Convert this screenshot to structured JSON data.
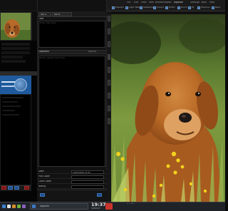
{
  "app": {
    "title": "digiKam",
    "menus": [
      "File",
      "Edit",
      "View",
      "Item",
      "Browse",
      "Import",
      "Settings",
      "Tools",
      "Help"
    ],
    "toolbar": [
      "Preview",
      "Light Table",
      "Slideshow",
      "Import",
      "Editor",
      "Zoom",
      "Fit",
      "Previous",
      "Next"
    ],
    "middle_tabs": [
      "Tab A",
      "Tab B"
    ]
  },
  "metadata_panel": {
    "title_label": "Title",
    "title_placeholder": "Enter title here.",
    "caption_label": "Captions",
    "caption_right": "Default",
    "caption_placeholder": "Enter caption text here.",
    "fields": [
      {
        "label": "Date",
        "value": "10/22/2013 14:37"
      },
      {
        "label": "Pick Label",
        "value": ""
      },
      {
        "label": "Color Label",
        "value": ""
      },
      {
        "label": "Rating",
        "value": ""
      }
    ]
  },
  "status": {
    "text": "1/1 item"
  },
  "taskbar": {
    "window_title": "digiKam",
    "time": "19:37",
    "date": "10/22/13"
  },
  "colors": {
    "accent_blue": "#1e5a9c",
    "alert_red": "#c8342b"
  },
  "icons": [
    "search-icon",
    "gear-icon",
    "image-icon",
    "folder-icon",
    "star-icon"
  ]
}
